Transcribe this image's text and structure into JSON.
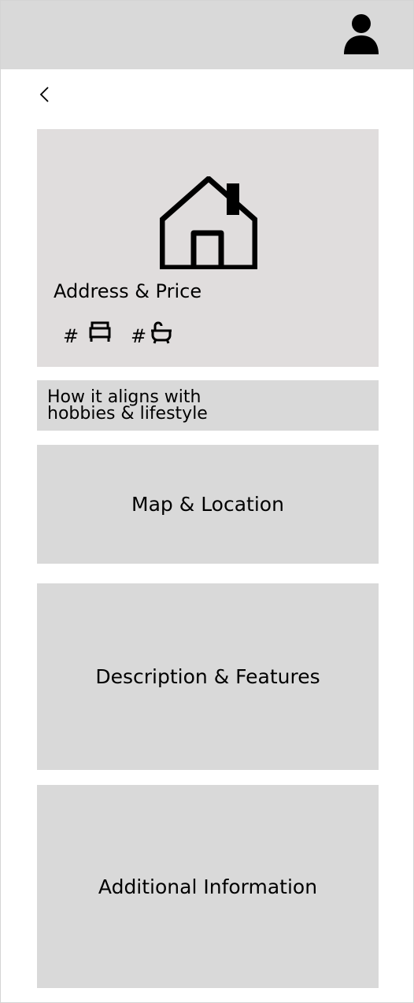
{
  "header": {
    "avatar_icon": "user-icon"
  },
  "nav": {
    "back_icon": "chevron-left-icon"
  },
  "listing": {
    "hero_icon": "house-icon",
    "address_price": "Address & Price",
    "bed_count": "#",
    "bed_icon": "bed-icon",
    "bath_count": "#",
    "bath_icon": "bathtub-icon"
  },
  "sections": {
    "hobbies_line1": "How it aligns with",
    "hobbies_line2": "hobbies & lifestyle",
    "map_location": "Map & Location",
    "description_features": "Description & Features",
    "additional_information": "Additional Information"
  },
  "colors": {
    "header_bg": "#d9d9d9",
    "hero_bg": "#e0dddd",
    "card_bg": "#d9d9d9"
  }
}
